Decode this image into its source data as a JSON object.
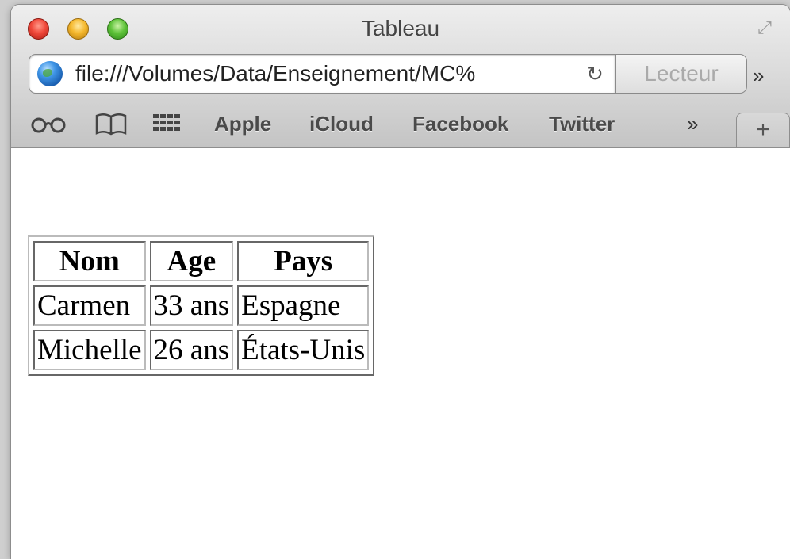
{
  "window": {
    "title": "Tableau",
    "url": "file:///Volumes/Data/Enseignement/MC%",
    "reader_label": "Lecteur",
    "overflow_label": "»"
  },
  "bookmarks": {
    "items": [
      "Apple",
      "iCloud",
      "Facebook",
      "Twitter"
    ],
    "overflow_label": "»",
    "new_tab_label": "+"
  },
  "table": {
    "headers": [
      "Nom",
      "Age",
      "Pays"
    ],
    "rows": [
      [
        "Carmen",
        "33 ans",
        "Espagne"
      ],
      [
        "Michelle",
        "26 ans",
        "États-Unis"
      ]
    ]
  },
  "icons": {
    "close": "close-icon",
    "minimize": "minimize-icon",
    "zoom": "zoom-icon",
    "fullscreen": "fullscreen-icon",
    "site": "globe-icon",
    "reload": "reload-icon",
    "reading_list": "reading-list-icon",
    "bookmarks": "bookmarks-icon",
    "top_sites": "top-sites-icon"
  }
}
